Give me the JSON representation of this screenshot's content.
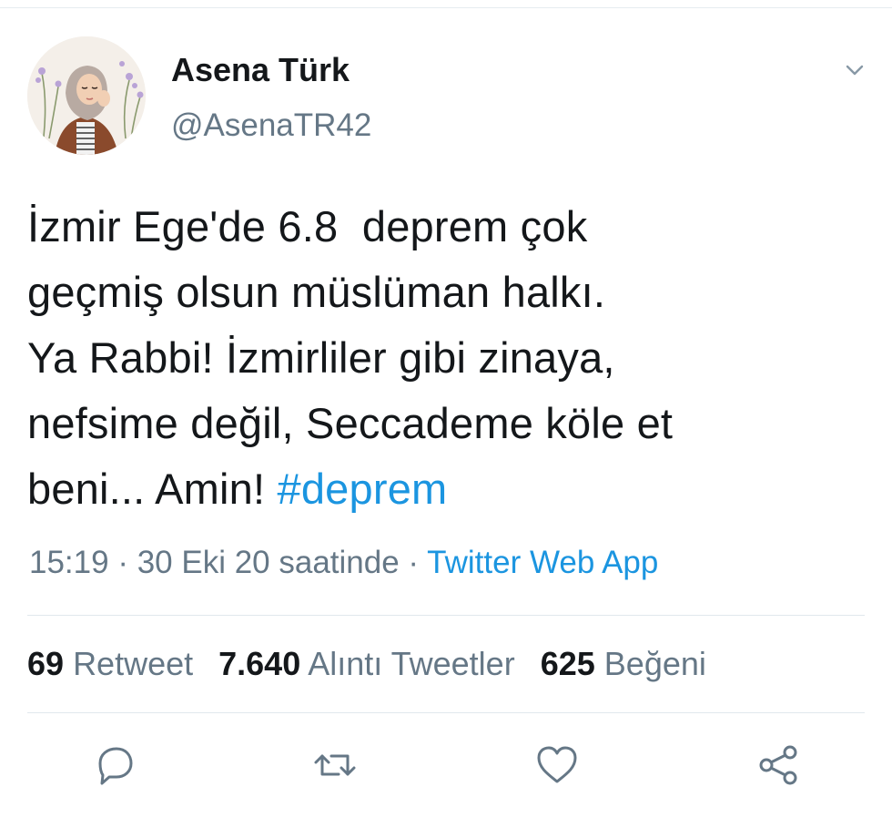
{
  "user": {
    "display_name": "Asena Türk",
    "handle": "@AsenaTR42"
  },
  "tweet": {
    "lines": [
      "İzmir Ege'de 6.8  deprem çok",
      "geçmiş olsun müslüman halkı.",
      "Ya Rabbi! İzmirliler gibi zinaya,",
      "nefsime değil, Seccademe köle et"
    ],
    "last_line_text": "beni... Amin! ",
    "hashtag": "#deprem"
  },
  "meta": {
    "time": "15:19",
    "separator": " · ",
    "date": "30 Eki 20 saatinde",
    "source": "Twitter Web App"
  },
  "stats": {
    "retweets": {
      "count": "69",
      "label": "Retweet"
    },
    "quotes": {
      "count": "7.640",
      "label": "Alıntı Tweetler"
    },
    "likes": {
      "count": "625",
      "label": "Beğeni"
    }
  },
  "icons": {
    "menu": "chevron-down-icon",
    "reply": "reply-icon",
    "retweet": "retweet-icon",
    "like": "heart-icon",
    "share": "share-icon"
  },
  "colors": {
    "text": "#14171a",
    "secondary": "#657786",
    "link": "#1b95e0",
    "divider": "#e1e8ed"
  }
}
